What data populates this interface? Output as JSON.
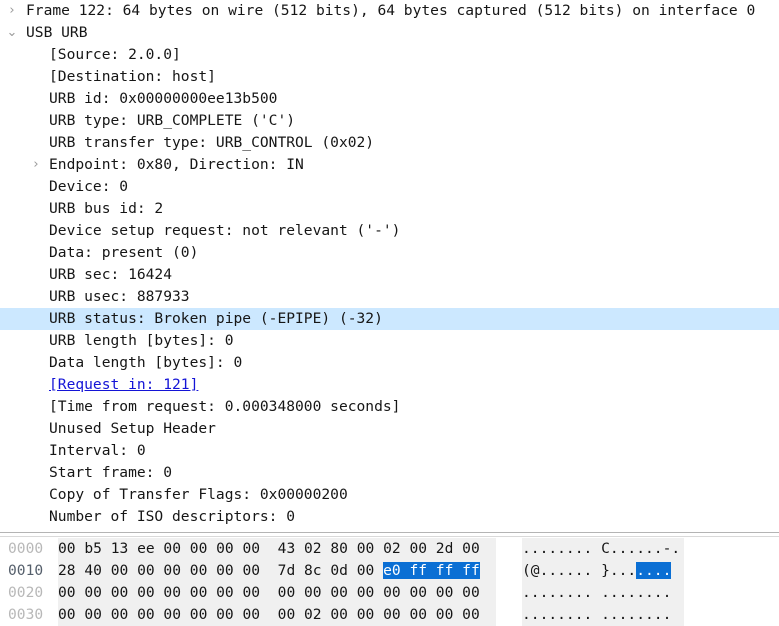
{
  "window": {
    "title": "Wireshark Packet Details",
    "app": "Wireshark"
  },
  "detail_tree": {
    "rows": [
      {
        "level": 0,
        "twisty": "collapsed",
        "twisty_glyph": "›",
        "text": "Frame 122: 64 bytes on wire (512 bits), 64 bytes captured (512 bits) on interface 0",
        "selected": false,
        "link": false
      },
      {
        "level": 0,
        "twisty": "expanded",
        "twisty_glyph": "⌄",
        "text": "USB URB",
        "selected": false,
        "link": false
      },
      {
        "level": 1,
        "twisty": "none",
        "twisty_glyph": "",
        "text": "[Source: 2.0.0]",
        "selected": false,
        "link": false
      },
      {
        "level": 1,
        "twisty": "none",
        "twisty_glyph": "",
        "text": "[Destination: host]",
        "selected": false,
        "link": false
      },
      {
        "level": 1,
        "twisty": "none",
        "twisty_glyph": "",
        "text": "URB id: 0x00000000ee13b500",
        "selected": false,
        "link": false
      },
      {
        "level": 1,
        "twisty": "none",
        "twisty_glyph": "",
        "text": "URB type: URB_COMPLETE ('C')",
        "selected": false,
        "link": false
      },
      {
        "level": 1,
        "twisty": "none",
        "twisty_glyph": "",
        "text": "URB transfer type: URB_CONTROL (0x02)",
        "selected": false,
        "link": false
      },
      {
        "level": 1,
        "twisty": "collapsed",
        "twisty_glyph": "›",
        "text": "Endpoint: 0x80, Direction: IN",
        "selected": false,
        "link": false
      },
      {
        "level": 1,
        "twisty": "none",
        "twisty_glyph": "",
        "text": "Device: 0",
        "selected": false,
        "link": false
      },
      {
        "level": 1,
        "twisty": "none",
        "twisty_glyph": "",
        "text": "URB bus id: 2",
        "selected": false,
        "link": false
      },
      {
        "level": 1,
        "twisty": "none",
        "twisty_glyph": "",
        "text": "Device setup request: not relevant ('-')",
        "selected": false,
        "link": false
      },
      {
        "level": 1,
        "twisty": "none",
        "twisty_glyph": "",
        "text": "Data: present (0)",
        "selected": false,
        "link": false
      },
      {
        "level": 1,
        "twisty": "none",
        "twisty_glyph": "",
        "text": "URB sec: 16424",
        "selected": false,
        "link": false
      },
      {
        "level": 1,
        "twisty": "none",
        "twisty_glyph": "",
        "text": "URB usec: 887933",
        "selected": false,
        "link": false
      },
      {
        "level": 1,
        "twisty": "none",
        "twisty_glyph": "",
        "text": "URB status: Broken pipe (-EPIPE) (-32)",
        "selected": true,
        "link": false
      },
      {
        "level": 1,
        "twisty": "none",
        "twisty_glyph": "",
        "text": "URB length [bytes]: 0",
        "selected": false,
        "link": false
      },
      {
        "level": 1,
        "twisty": "none",
        "twisty_glyph": "",
        "text": "Data length [bytes]: 0",
        "selected": false,
        "link": false
      },
      {
        "level": 1,
        "twisty": "none",
        "twisty_glyph": "",
        "text": "[Request in: 121]",
        "selected": false,
        "link": true
      },
      {
        "level": 1,
        "twisty": "none",
        "twisty_glyph": "",
        "text": "[Time from request: 0.000348000 seconds]",
        "selected": false,
        "link": false
      },
      {
        "level": 1,
        "twisty": "none",
        "twisty_glyph": "",
        "text": "Unused Setup Header",
        "selected": false,
        "link": false
      },
      {
        "level": 1,
        "twisty": "none",
        "twisty_glyph": "",
        "text": "Interval: 0",
        "selected": false,
        "link": false
      },
      {
        "level": 1,
        "twisty": "none",
        "twisty_glyph": "",
        "text": "Start frame: 0",
        "selected": false,
        "link": false
      },
      {
        "level": 1,
        "twisty": "none",
        "twisty_glyph": "",
        "text": "Copy of Transfer Flags: 0x00000200",
        "selected": false,
        "link": false
      },
      {
        "level": 1,
        "twisty": "none",
        "twisty_glyph": "",
        "text": "Number of ISO descriptors: 0",
        "selected": false,
        "link": false
      }
    ]
  },
  "hex_dump": {
    "rows": [
      {
        "offset": "0000",
        "active": false,
        "bytes_pre": "00 b5 13 ee 00 00 00 00  43 02 80 00 02 00 2d 00",
        "bytes_sel": "",
        "bytes_post": "",
        "ascii_pre": "........ C......-.",
        "ascii_sel": "",
        "ascii_post": ""
      },
      {
        "offset": "0010",
        "active": true,
        "bytes_pre": "28 40 00 00 00 00 00 00  7d 8c 0d 00 ",
        "bytes_sel": "e0 ff ff ff",
        "bytes_post": "",
        "ascii_pre": "(@...... }...",
        "ascii_sel": "....",
        "ascii_post": ""
      },
      {
        "offset": "0020",
        "active": false,
        "bytes_pre": "00 00 00 00 00 00 00 00  00 00 00 00 00 00 00 00",
        "bytes_sel": "",
        "bytes_post": "",
        "ascii_pre": "........ ........",
        "ascii_sel": "",
        "ascii_post": ""
      },
      {
        "offset": "0030",
        "active": false,
        "bytes_pre": "00 00 00 00 00 00 00 00  00 02 00 00 00 00 00 00",
        "bytes_sel": "",
        "bytes_post": "",
        "ascii_pre": "........ ........",
        "ascii_sel": "",
        "ascii_post": ""
      }
    ]
  },
  "colors": {
    "selection_row": "#cce8ff",
    "selection_bytes": "#0b6fd4",
    "hex_background": "#f0f0f0",
    "link": "#1414d6",
    "text": "#161616",
    "offset": "#b8b8b8"
  }
}
